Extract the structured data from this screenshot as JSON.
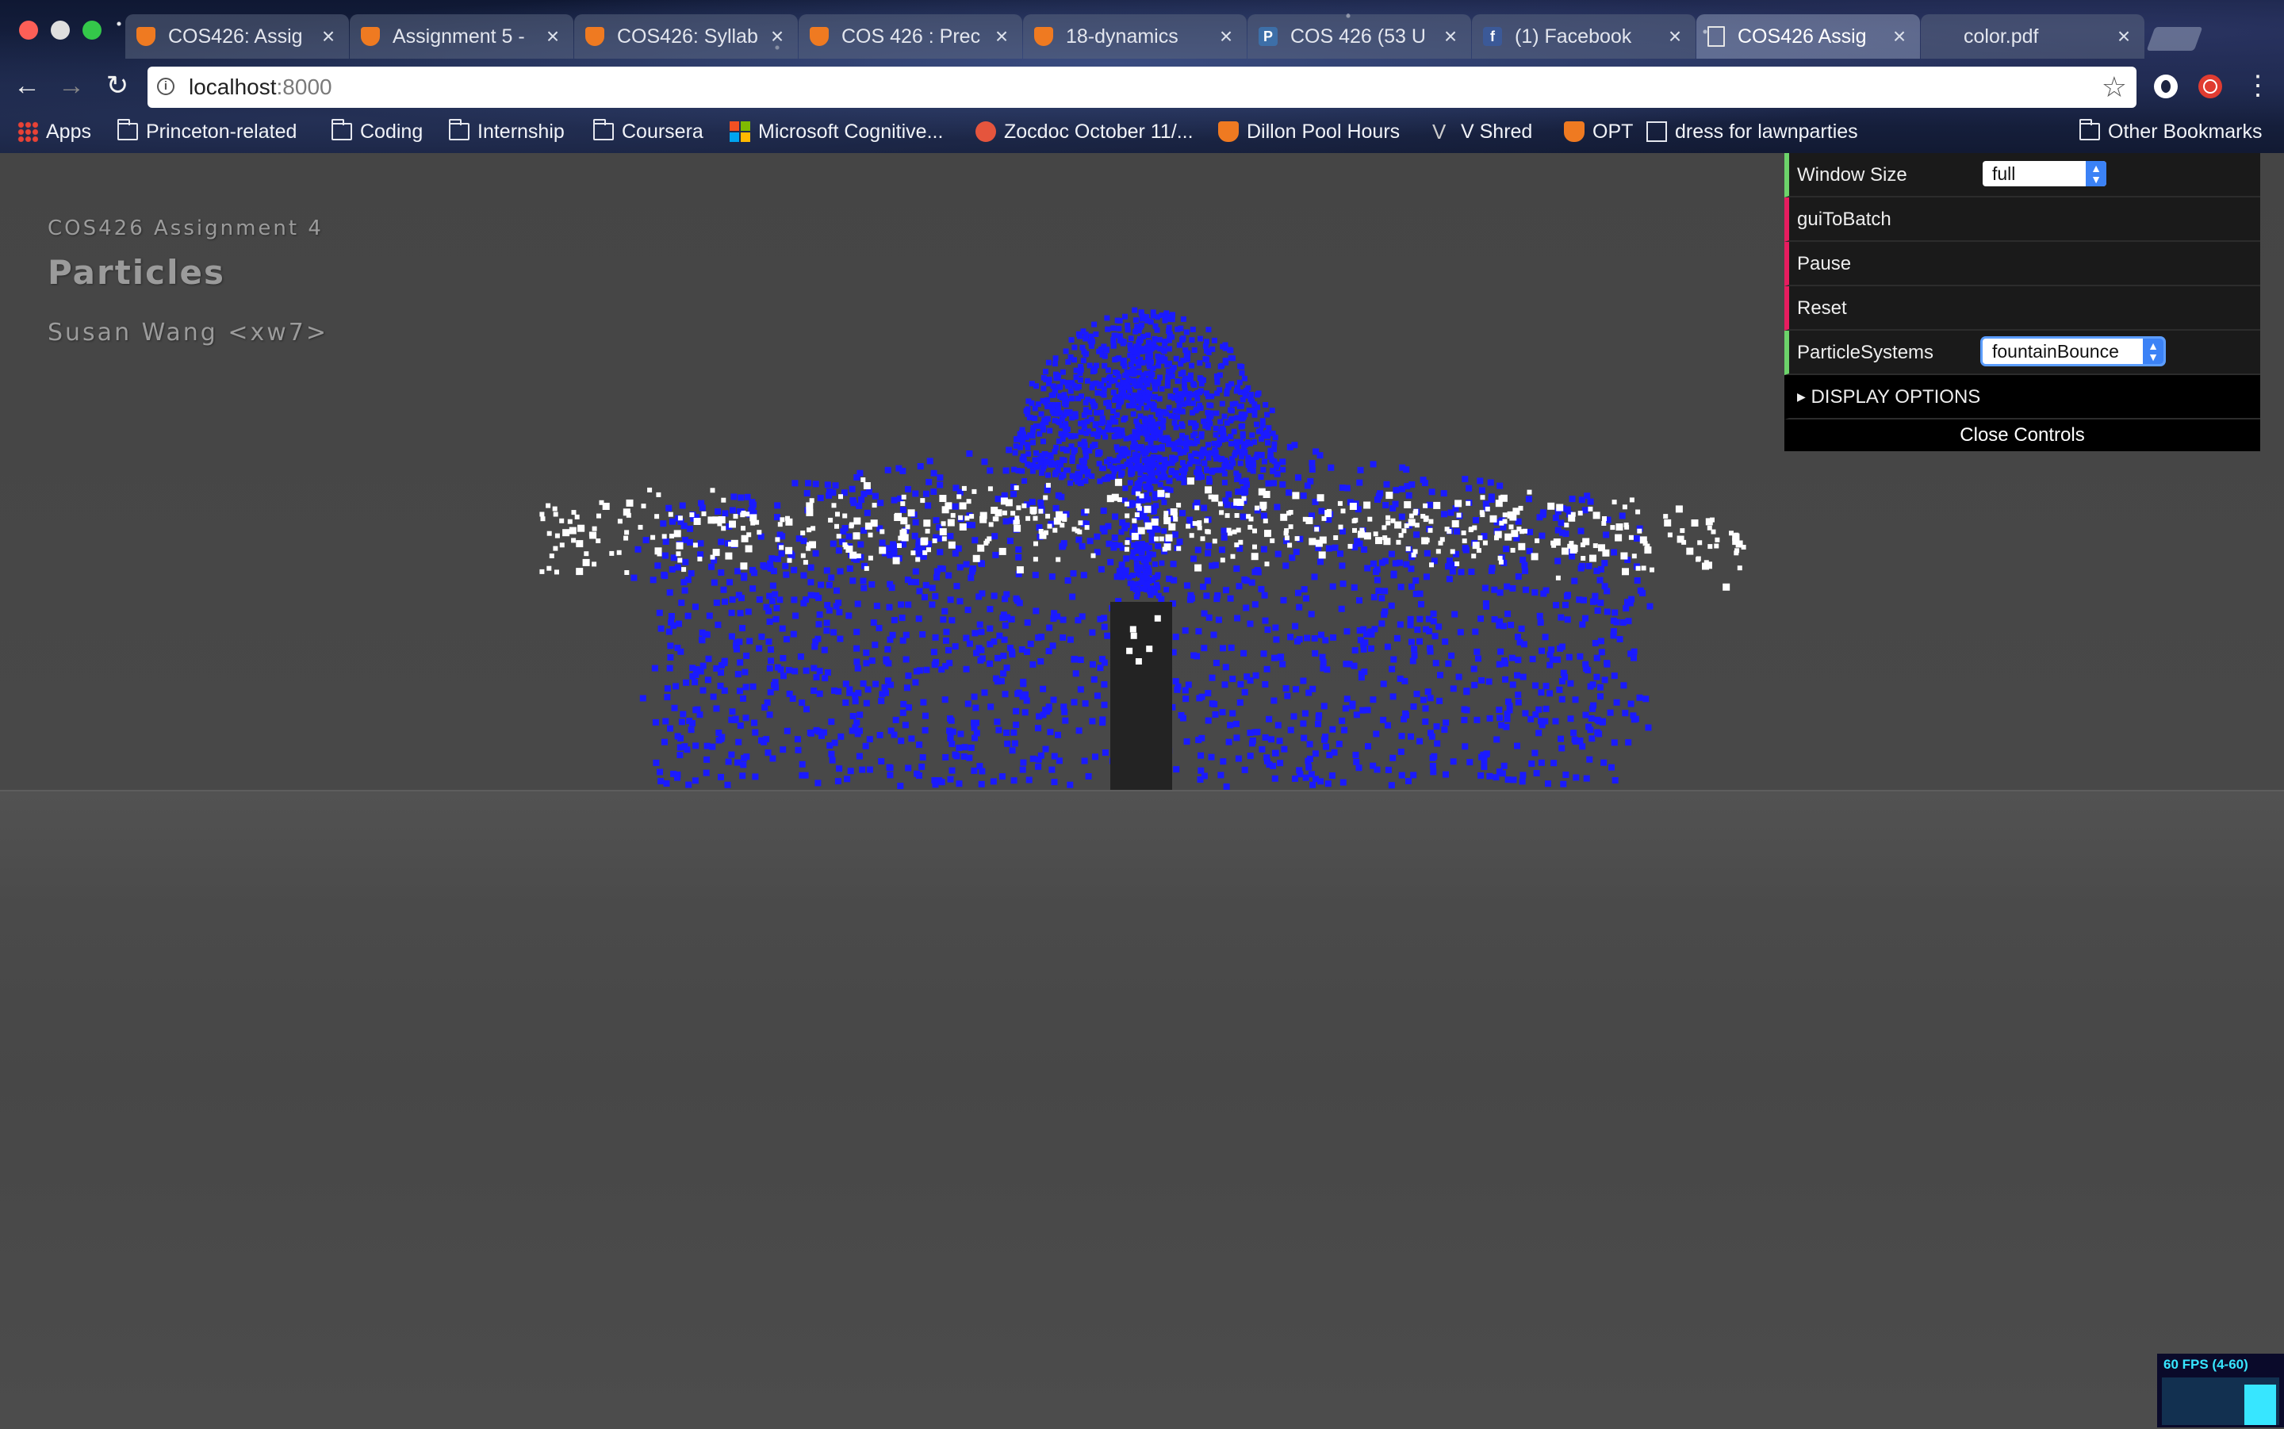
{
  "browser": {
    "tabs": [
      {
        "title": "COS426: Assig",
        "favicon": "shield-icon",
        "active": false
      },
      {
        "title": "Assignment 5 -",
        "favicon": "shield-icon",
        "active": false
      },
      {
        "title": "COS426: Syllab",
        "favicon": "shield-icon",
        "active": false
      },
      {
        "title": "COS 426 : Prec",
        "favicon": "shield-icon",
        "active": false
      },
      {
        "title": "18-dynamics",
        "favicon": "shield-icon",
        "active": false
      },
      {
        "title": "COS 426 (53 U",
        "favicon": "piazza-icon",
        "active": false
      },
      {
        "title": "(1) Facebook",
        "favicon": "facebook-icon",
        "active": false
      },
      {
        "title": "COS426 Assig",
        "favicon": "document-icon",
        "active": true
      },
      {
        "title": "color.pdf",
        "favicon": "none",
        "active": false
      }
    ],
    "url": {
      "host": "localhost",
      "port": ":8000"
    },
    "bookmarks": [
      {
        "label": "Apps",
        "icon": "apps-grid-icon"
      },
      {
        "label": "Princeton-related",
        "icon": "folder-icon"
      },
      {
        "label": "Coding",
        "icon": "folder-icon"
      },
      {
        "label": "Internship",
        "icon": "folder-icon"
      },
      {
        "label": "Coursera",
        "icon": "folder-icon"
      },
      {
        "label": "Microsoft Cognitive...",
        "icon": "microsoft-icon"
      },
      {
        "label": "Zocdoc October 11/...",
        "icon": "zocdoc-icon"
      },
      {
        "label": "Dillon Pool Hours",
        "icon": "shield-icon"
      },
      {
        "label": "V Shred",
        "icon": "v-icon"
      },
      {
        "label": "OPT",
        "icon": "shield-icon"
      },
      {
        "label": "dress for lawnparties",
        "icon": "document-icon"
      }
    ],
    "other_bookmarks": "Other Bookmarks"
  },
  "page": {
    "course": "COS426 Assignment 4",
    "title": "Particles",
    "author": "Susan Wang <xw7>"
  },
  "gui": {
    "window_size_label": "Window Size",
    "window_size_value": "full",
    "gui_to_batch_label": "guiToBatch",
    "pause_label": "Pause",
    "reset_label": "Reset",
    "particle_systems_label": "ParticleSystems",
    "particle_systems_value": "fountainBounce",
    "display_options_label": "DISPLAY OPTIONS",
    "close_controls_label": "Close Controls"
  },
  "stats": {
    "fps_text": "60 FPS (4-60)",
    "fps_fraction": 0.85
  },
  "scene": {
    "background_color": "#454545",
    "particle_color": "#1a1aff",
    "bounced_particle_color": "#ffffff",
    "fountain_color": "#232323"
  }
}
